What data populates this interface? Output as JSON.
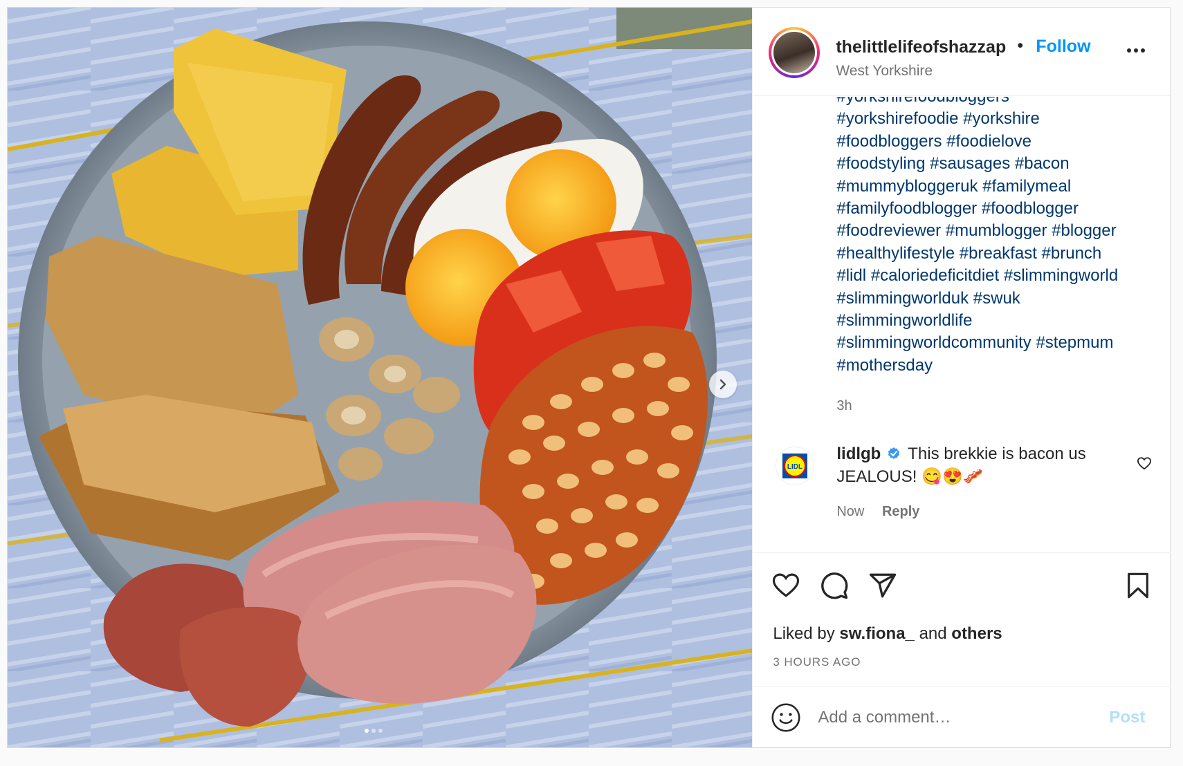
{
  "post": {
    "username": "thelittlelifeofshazzap",
    "separator": "•",
    "follow_label": "Follow",
    "location": "West Yorkshire",
    "image_alt": "Full English breakfast plate",
    "carousel": {
      "current": 1,
      "total": 3
    }
  },
  "caption": {
    "hashtags": [
      [
        "#yorkshirefoodbloggers"
      ],
      [
        "#yorkshirefoodie",
        "#yorkshire"
      ],
      [
        "#foodbloggers",
        "#foodielove"
      ],
      [
        "#foodstyling",
        "#sausages",
        "#bacon"
      ],
      [
        "#mummybloggeruk",
        "#familymeal"
      ],
      [
        "#familyfoodblogger",
        "#foodblogger"
      ],
      [
        "#foodreviewer",
        "#mumblogger",
        "#blogger"
      ],
      [
        "#healthylifestyle",
        "#breakfast",
        "#brunch"
      ],
      [
        "#lidl",
        "#caloriedeficitdiet",
        "#slimmingworld"
      ],
      [
        "#slimmingworlduk",
        "#swuk"
      ],
      [
        "#slimmingworldlife"
      ],
      [
        "#slimmingworldcommunity",
        "#stepmum"
      ],
      [
        "#mothersday"
      ]
    ],
    "time": "3h"
  },
  "comment": {
    "user": "lidlgb",
    "text": "This brekkie is bacon us JEALOUS! 😋😍🥓",
    "time": "Now",
    "reply_label": "Reply",
    "avatar_text": "LIDL"
  },
  "actions": {
    "liked_prefix": "Liked by",
    "liked_user": "sw.fiona_",
    "liked_and": "and",
    "liked_others": "others",
    "timestamp": "3 HOURS AGO"
  },
  "add_comment": {
    "placeholder": "Add a comment…",
    "post_label": "Post"
  },
  "colors": {
    "link": "#00376b",
    "follow": "#0095f6",
    "muted": "#737373",
    "post_disabled": "#b2dffc"
  }
}
